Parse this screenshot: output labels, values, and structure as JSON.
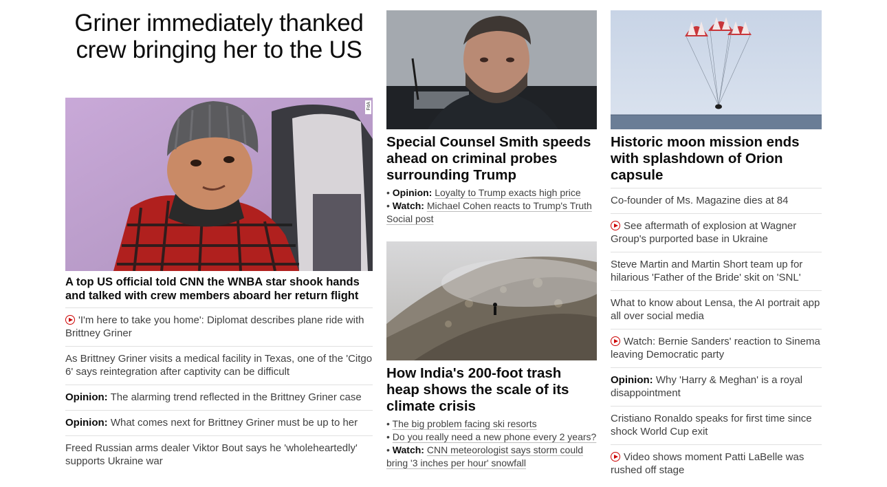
{
  "left": {
    "title": "Griner immediately thanked crew bringing her to the US",
    "image_badge": "FitA",
    "subhead": "A top US official told CNN the WNBA star shook hands and talked with crew members aboard her return flight",
    "items": [
      {
        "label": "",
        "text": "'I'm here to take you home': Diplomat describes plane ride with Brittney Griner",
        "video": true
      },
      {
        "label": "",
        "text": "As Brittney Griner visits a medical facility in Texas, one of the 'Citgo 6' says reintegration after captivity can be difficult",
        "video": false
      },
      {
        "label": "Opinion:",
        "text": "The alarming trend reflected in the Brittney Griner case",
        "video": false
      },
      {
        "label": "Opinion:",
        "text": "What comes next for Brittney Griner must be up to her",
        "video": false
      },
      {
        "label": "",
        "text": "Freed Russian arms dealer Viktor Bout says he 'wholeheartedly' supports Ukraine war",
        "video": false
      }
    ]
  },
  "middle": {
    "story1": {
      "headline": "Special Counsel Smith speeds ahead on criminal probes surrounding Trump",
      "bullets": [
        {
          "label": "Opinion:",
          "text": "Loyalty to Trump exacts high price"
        },
        {
          "label": "Watch:",
          "text": "Michael Cohen reacts to Trump's Truth Social post"
        }
      ]
    },
    "story2": {
      "headline": "How India's 200-foot trash heap shows the scale of its climate crisis",
      "bullets": [
        {
          "label": "",
          "text": "The big problem facing ski resorts"
        },
        {
          "label": "",
          "text": "Do you really need a new phone every 2 years?"
        },
        {
          "label": "Watch:",
          "text": "CNN meteorologist says storm could bring '3 inches per hour' snowfall"
        }
      ]
    }
  },
  "right": {
    "headline": "Historic moon mission ends with splashdown of Orion capsule",
    "items": [
      {
        "label": "",
        "text": "Co-founder of Ms. Magazine dies at 84",
        "video": false
      },
      {
        "label": "",
        "text": "See aftermath of explosion at Wagner Group's purported base in Ukraine",
        "video": true
      },
      {
        "label": "",
        "text": "Steve Martin and Martin Short team up for hilarious 'Father of the Bride' skit on 'SNL'",
        "video": false
      },
      {
        "label": "",
        "text": "What to know about Lensa, the AI portrait app all over social media",
        "video": false
      },
      {
        "label": "",
        "text": "Watch: Bernie Sanders' reaction to Sinema leaving Democratic party",
        "video": true
      },
      {
        "label": "Opinion:",
        "text": "Why 'Harry & Meghan' is a royal disappointment",
        "video": false
      },
      {
        "label": "",
        "text": "Cristiano Ronaldo speaks for first time since shock World Cup exit",
        "video": false
      },
      {
        "label": "",
        "text": "Video shows moment Patti LaBelle was rushed off stage",
        "video": true
      }
    ]
  },
  "icons": {
    "video": "play-circle-icon"
  },
  "colors": {
    "accent": "#cc0000",
    "text": "#0c0c0c",
    "secondary": "#404040",
    "divider": "#e0e0e0"
  }
}
